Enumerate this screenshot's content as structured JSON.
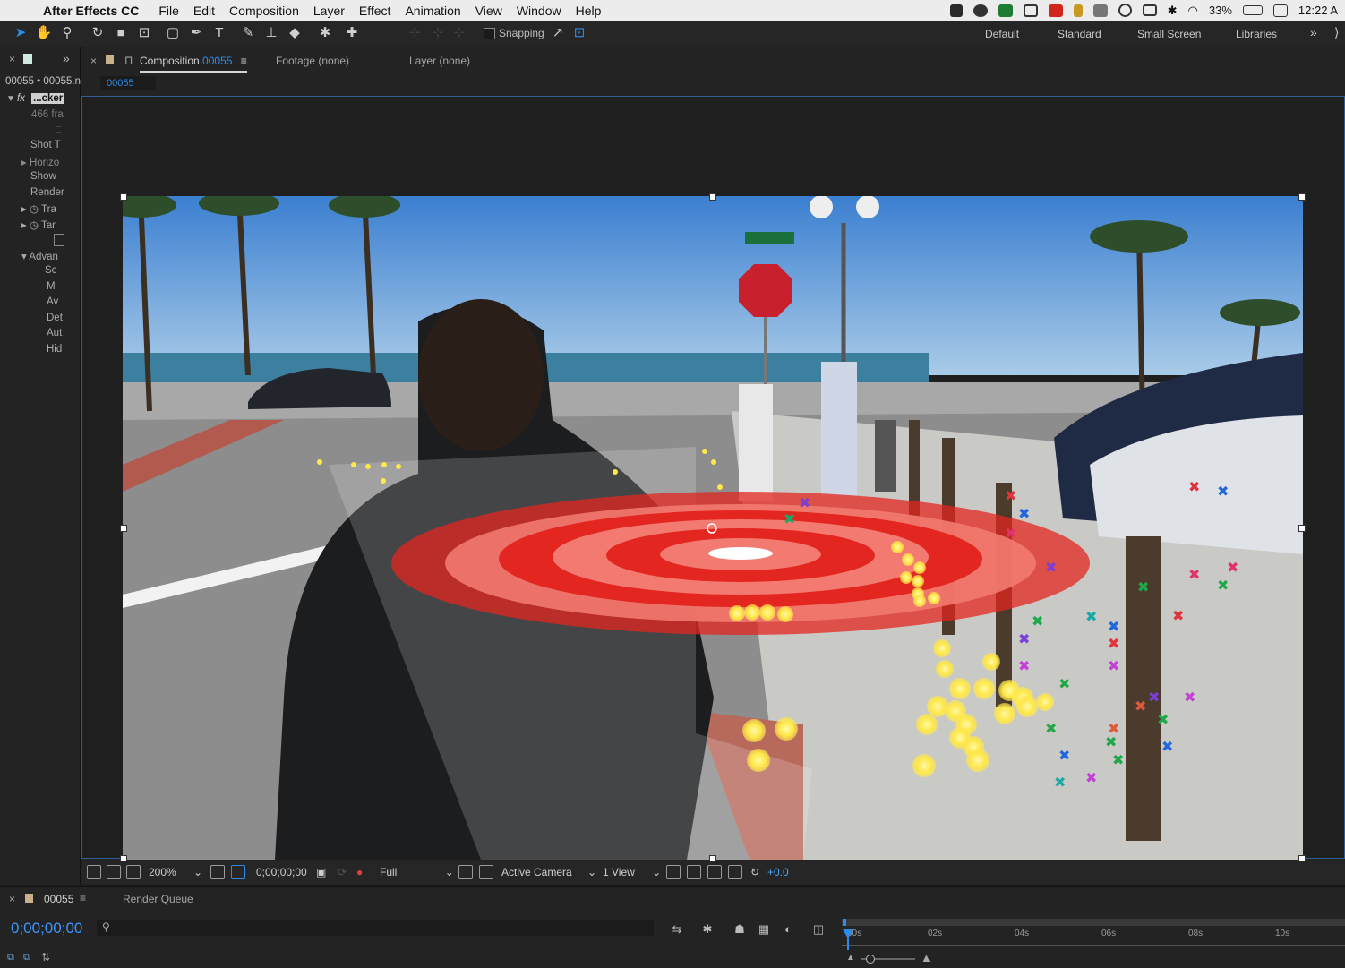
{
  "menubar": {
    "app_name": "After Effects CC",
    "items": [
      "File",
      "Edit",
      "Composition",
      "Layer",
      "Effect",
      "Animation",
      "View",
      "Window",
      "Help"
    ],
    "battery": "33%",
    "clock": "12:22 A"
  },
  "toolbar": {
    "snapping_label": "Snapping",
    "workspaces": [
      "Default",
      "Standard",
      "Small Screen",
      "Libraries"
    ],
    "more": "»"
  },
  "left_panel": {
    "header": "00055 • 00055.n",
    "effect_name": "...cker",
    "rows": [
      "466 fra",
      "Shot T",
      "Horizo",
      "Show",
      "Render",
      "Tra",
      "Tar",
      "Advan",
      "Sc",
      "M",
      "Av",
      "Det",
      "Aut",
      "Hid"
    ]
  },
  "comp_panel": {
    "tabs": {
      "composition_label": "Composition",
      "composition_name": "00055",
      "footage": "Footage (none)",
      "layer": "Layer (none)"
    },
    "breadcrumb": "00055"
  },
  "viewer_footer": {
    "zoom": "200%",
    "timecode": "0;00;00;00",
    "resolution": "Full",
    "camera": "Active Camera",
    "views": "1 View",
    "exposure": "+0.0"
  },
  "timeline": {
    "tab_name": "00055",
    "render_queue": "Render Queue",
    "timecode": "0;00;00;00",
    "search_placeholder": "",
    "ruler": [
      "00s",
      "02s",
      "04s",
      "06s",
      "08s",
      "10s"
    ],
    "playhead_time_seconds": 0
  },
  "colors": {
    "accent": "#2d8ceb",
    "timecode": "#3a95ff",
    "exposure": "#4aa8ff",
    "selection_border": "#2f5f95",
    "track_point_yellow": "#ffe84a",
    "target_red": "#e3261f"
  }
}
